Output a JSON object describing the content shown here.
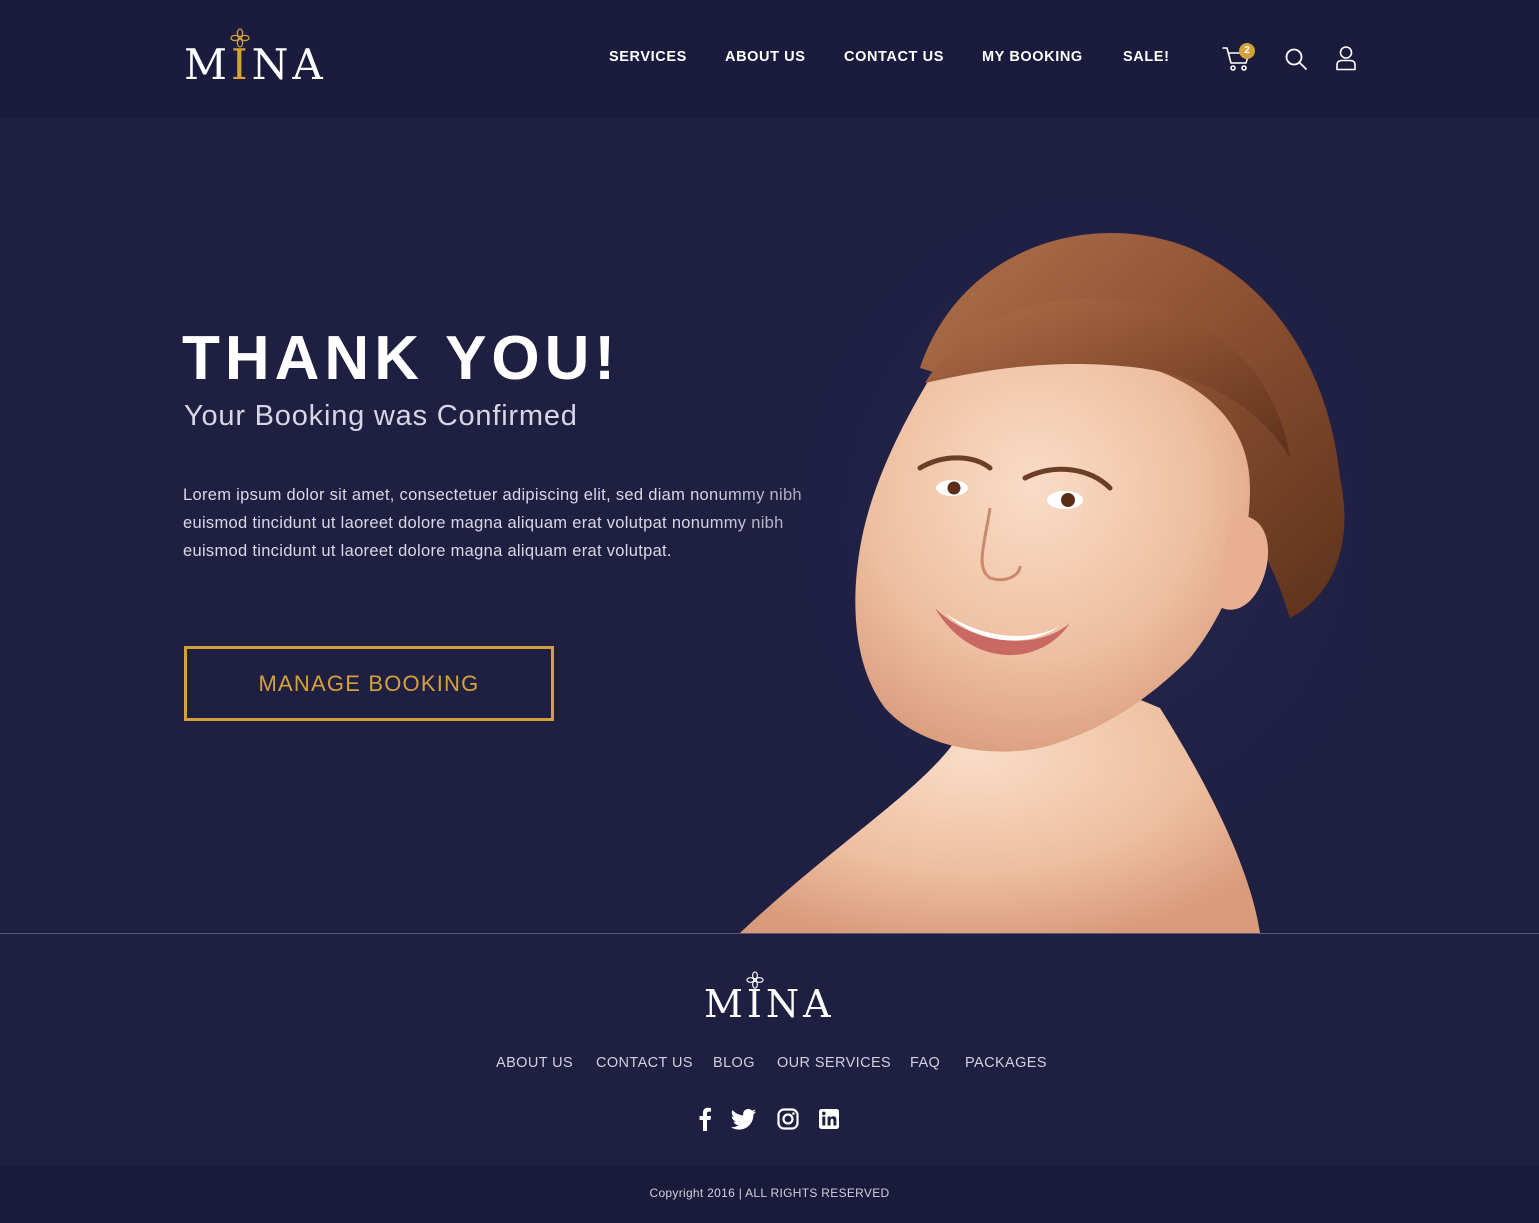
{
  "brand": {
    "name_start": "M",
    "name_accent": "I",
    "name_end": "NA",
    "accent_color": "#d4a23a",
    "background_color": "#1f1f42"
  },
  "header": {
    "nav": [
      "SERVICES",
      "ABOUT US",
      "CONTACT US",
      "MY BOOKING",
      "SALE!"
    ],
    "cart_icon": "cart-icon",
    "cart_count": "2",
    "search_icon": "search-icon",
    "user_icon": "user-icon"
  },
  "hero": {
    "title": "THANK YOU!",
    "subtitle": "Your Booking was Confirmed",
    "body": "Lorem ipsum dolor sit amet, consectetuer adipiscing elit, sed diam nonummy nibh euismod tincidunt ut laoreet dolore magna aliquam erat volutpat nonummy nibh euismod tincidunt ut laoreet dolore magna aliquam erat volutpat.",
    "button_label": "MANAGE BOOKING"
  },
  "footer": {
    "brand": "MINA",
    "links": [
      "ABOUT US",
      "CONTACT US",
      "BLOG",
      "OUR SERVICES",
      "FAQ",
      "PACKAGES"
    ],
    "social": [
      "facebook-icon",
      "twitter-icon",
      "instagram-icon",
      "linkedin-icon"
    ],
    "copyright": "Copyright 2016 | ALL RIGHTS RESERVED"
  }
}
